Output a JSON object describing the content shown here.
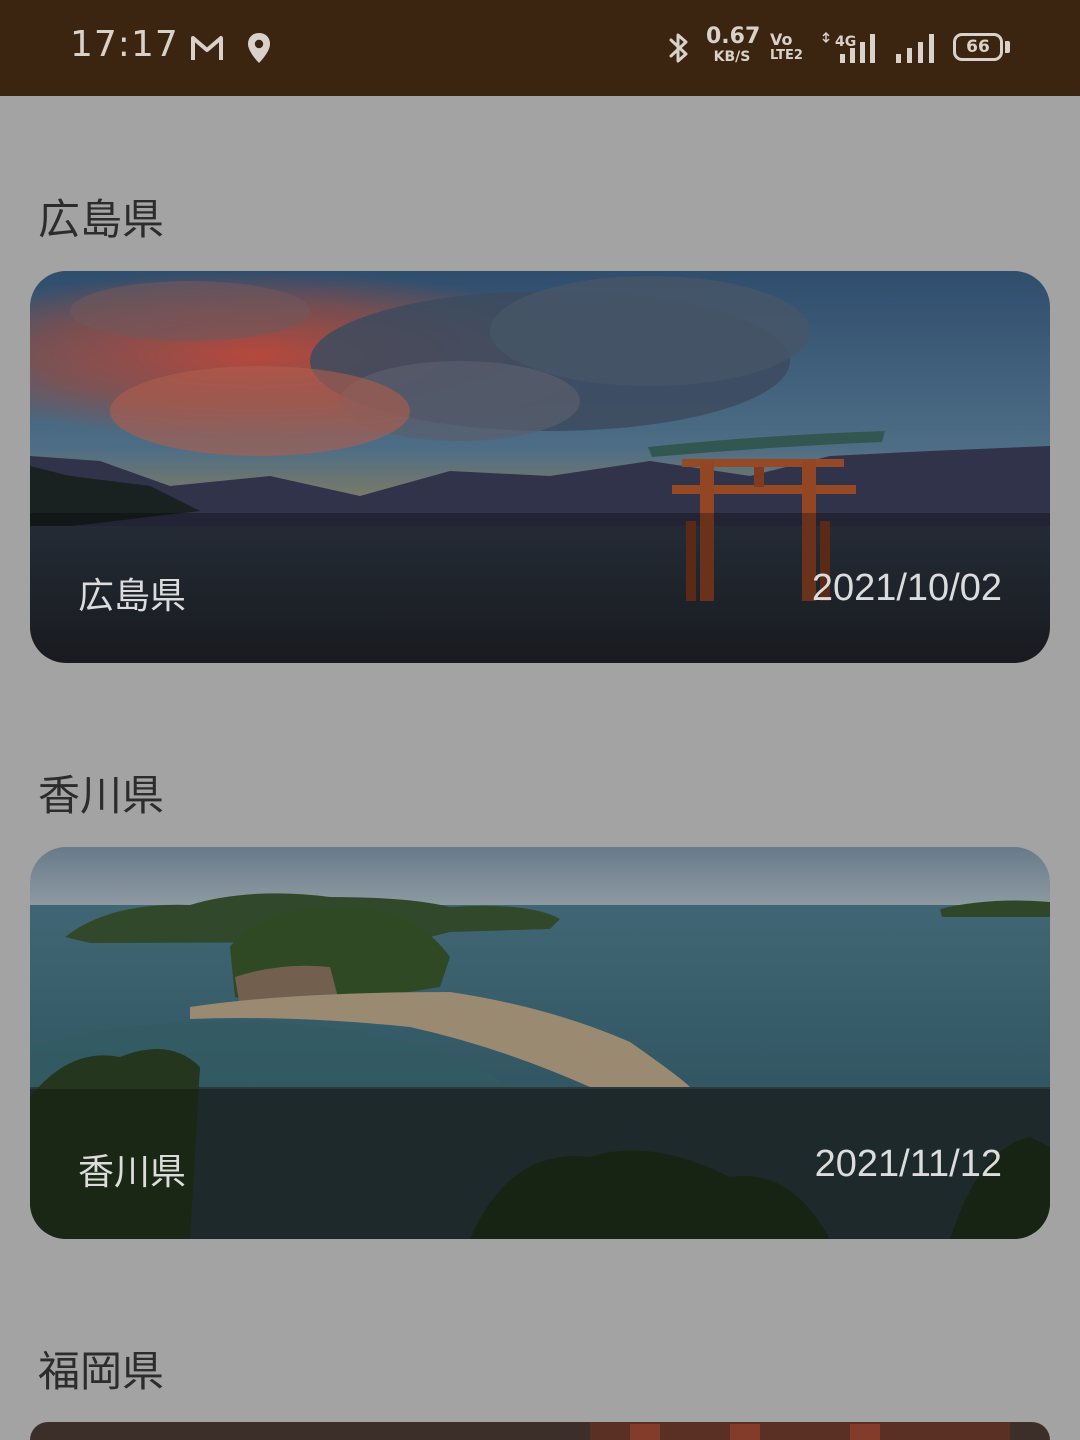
{
  "status_bar": {
    "time": "17:17",
    "net_speed_value": "0.67",
    "net_speed_unit": "KB/S",
    "volte_top": "Vo",
    "volte_bottom": "LTE2",
    "network_type": "4G",
    "battery_level": "66",
    "icons": [
      "gmail-icon",
      "location-icon",
      "bluetooth-icon",
      "signal-icon",
      "signal-icon-2",
      "battery-icon"
    ]
  },
  "sections": [
    {
      "title": "広島県",
      "card_name": "広島県",
      "card_date": "2021/10/02"
    },
    {
      "title": "香川県",
      "card_name": "香川県",
      "card_date": "2021/11/12"
    },
    {
      "title": "福岡県"
    }
  ]
}
